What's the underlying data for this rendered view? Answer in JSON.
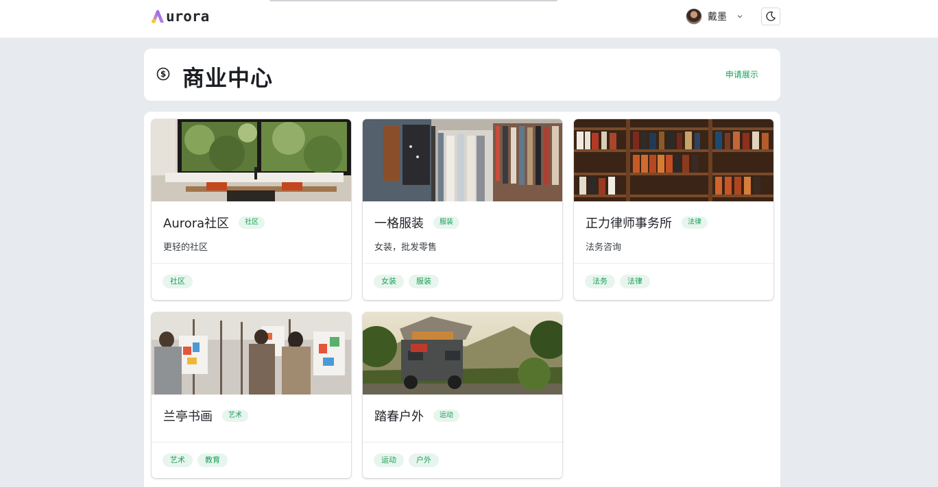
{
  "header": {
    "logo_text": "urora",
    "user_name": "戴墨"
  },
  "page": {
    "title": "商业中心",
    "apply_link": "申请展示"
  },
  "cards": [
    {
      "title": "Aurora社区",
      "category": "社区",
      "desc": "更轻的社区",
      "tags": [
        "社区"
      ],
      "image": "cafe-interior-photo"
    },
    {
      "title": "一格服装",
      "category": "服装",
      "desc": "女装，批发零售",
      "tags": [
        "女装",
        "服装"
      ],
      "image": "clothing-rack-photo"
    },
    {
      "title": "正力律师事务所",
      "category": "法律",
      "desc": "法务咨询",
      "tags": [
        "法务",
        "法律"
      ],
      "image": "bookshelf-photo"
    },
    {
      "title": "兰亭书画",
      "category": "艺术",
      "desc": "",
      "tags": [
        "艺术",
        "教育"
      ],
      "image": "painting-class-photo"
    },
    {
      "title": "踏春户外",
      "category": "运动",
      "desc": "",
      "tags": [
        "运动",
        "户外"
      ],
      "image": "camping-car-photo"
    }
  ],
  "colors": {
    "accent": "#18a058",
    "accent_bg": "#e8f5ee",
    "page_bg": "#e7eaee",
    "logo_gradient": [
      "#f5c842",
      "#8b5cf6"
    ]
  }
}
